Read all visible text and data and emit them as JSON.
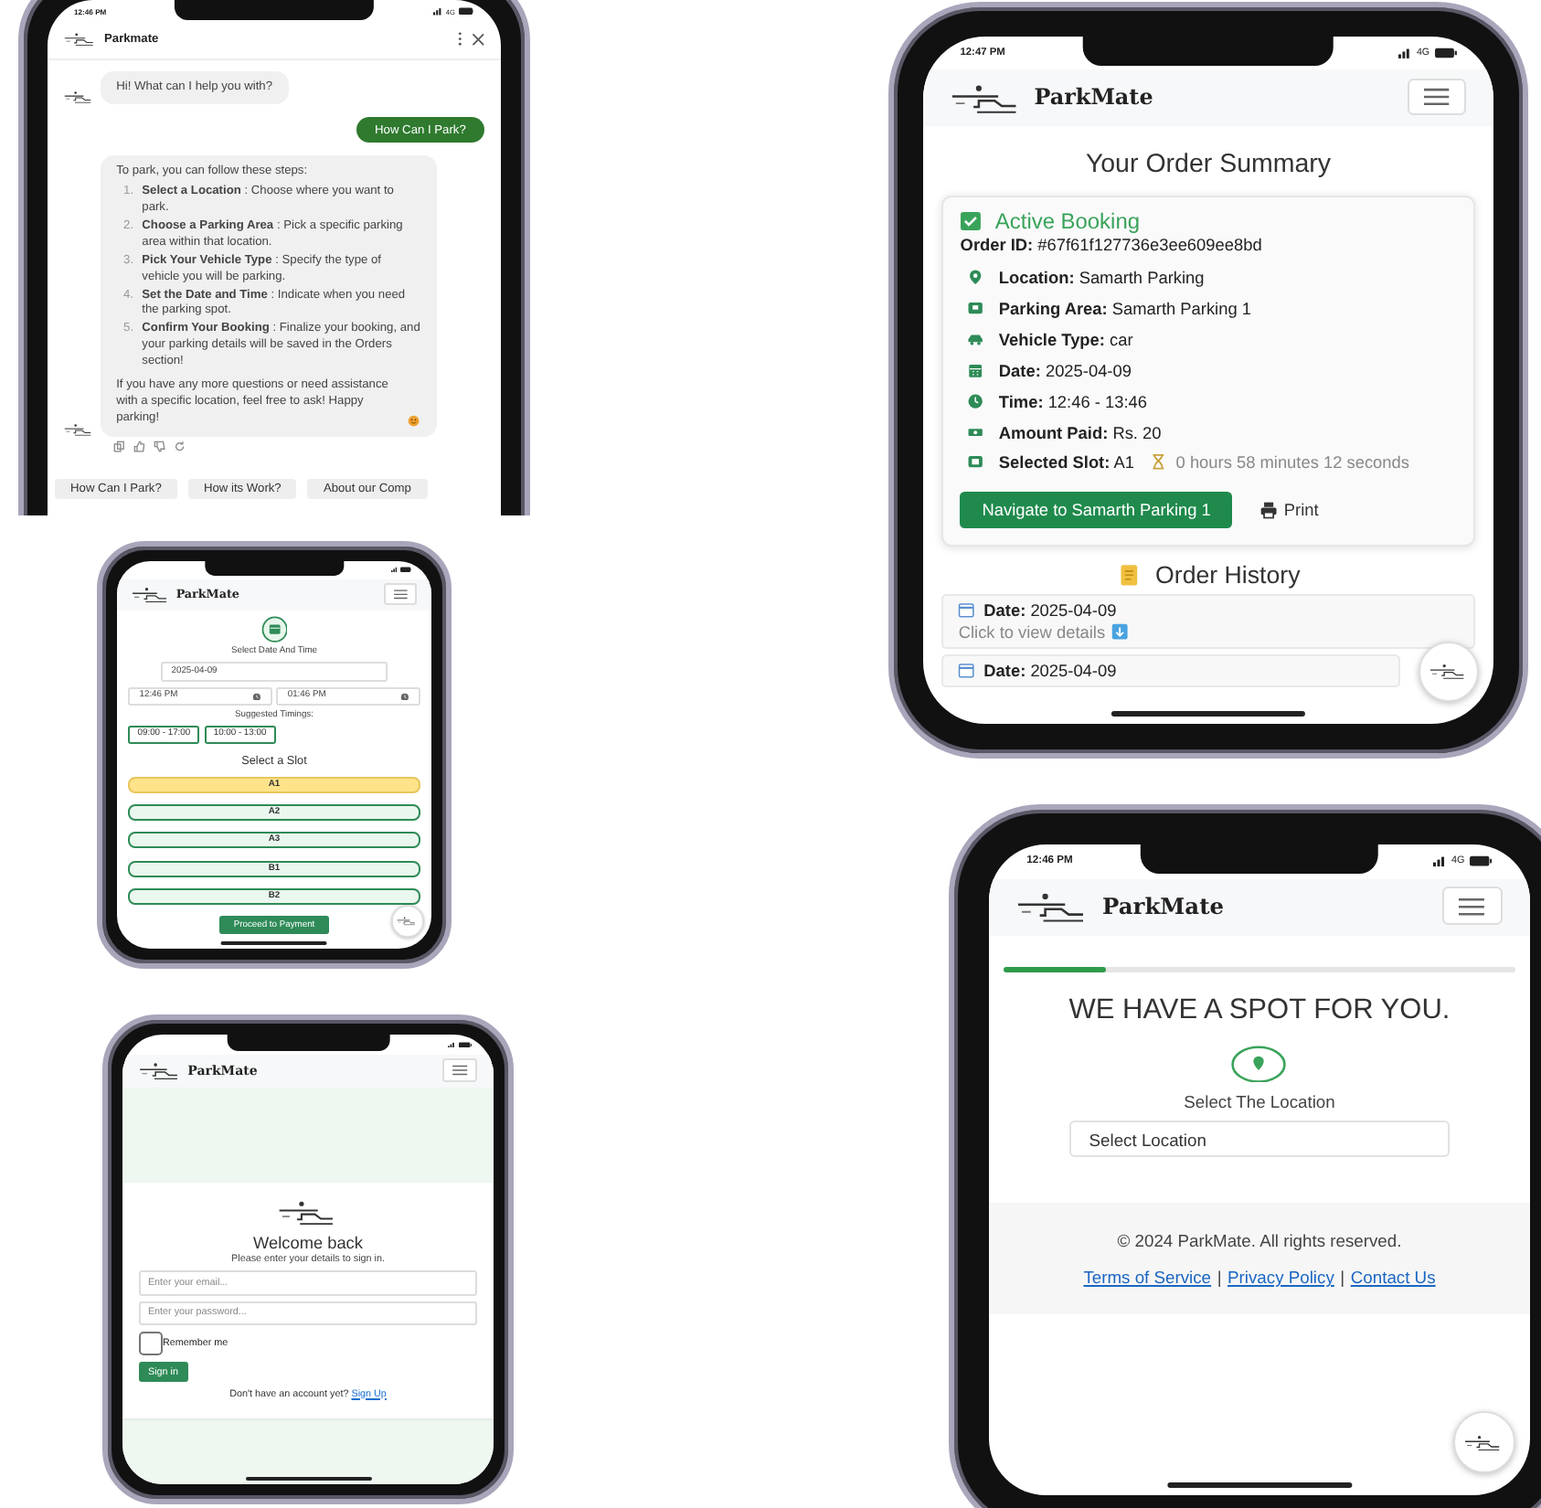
{
  "phones": [
    {
      "kind": "chat",
      "status": {
        "time": "12:46 PM",
        "network": "4G"
      },
      "header": {
        "title": "Parkmate"
      },
      "messages": [
        {
          "kind": "bot",
          "text": "Hi! What can I help you with?"
        },
        {
          "kind": "user",
          "text": "How Can I Park?"
        },
        {
          "kind": "steps",
          "intro": "To park, you can follow these steps:",
          "steps": [
            {
              "number": "1.",
              "text": "**Select a Location** : Choose where you want to park."
            },
            {
              "number": "2.",
              "text": "**Choose a Parking Area** : Pick a specific parking area within that location."
            },
            {
              "number": "3.",
              "text": "**Pick Your Vehicle Type** : Specify the type of vehicle you will be parking."
            },
            {
              "number": "4.",
              "text": "**Set the Date and Time** : Indicate when you need the parking spot."
            },
            {
              "number": "5.",
              "text": "**Confirm Your Booking** : Finalize your booking, and your parking details will be saved in the Orders section!"
            }
          ],
          "outro": "If you have any more questions or need assistance with a specific location, feel free to ask! Happy parking!"
        }
      ],
      "suggestions": [
        "How Can I Park?",
        "How its Work?",
        "About our Comp"
      ]
    },
    {
      "kind": "slots",
      "navbar": {
        "brand": "ParkMate"
      },
      "heading": "Select Date And Time",
      "date": "2025-04-09",
      "start_time": "12:46 PM",
      "end_time": "01:46 PM",
      "suggested_label": "Suggested Timings:",
      "timings": [
        "09:00 - 17:00",
        "10:00 - 13:00"
      ],
      "slot_heading": "Select a Slot",
      "slots": [
        {
          "label": "A1",
          "selected": true
        },
        {
          "label": "A2",
          "selected": false
        },
        {
          "label": "A3",
          "selected": false
        },
        {
          "label": "B1",
          "selected": false
        },
        {
          "label": "B2",
          "selected": false
        }
      ],
      "proceed": "Proceed to Payment"
    },
    {
      "kind": "login",
      "navbar": {
        "brand": "ParkMate"
      },
      "title": "Welcome back",
      "subtitle": "Please enter your details to sign in.",
      "email_placeholder": "Enter your email...",
      "password_placeholder": "Enter your password...",
      "remember": {
        "label": "Remember me",
        "checked": false
      },
      "submit": "Sign in",
      "signup_prompt": "Don't have an account yet?",
      "signup_link": "Sign Up"
    },
    {
      "kind": "order",
      "status": {
        "time": "12:47 PM",
        "network": "4G"
      },
      "navbar": {
        "brand": "ParkMate"
      },
      "title": "Your Order Summary",
      "booking": {
        "status": "Active Booking",
        "order_id": "**Order ID:** #67f61f127736e3ee609ee8bd",
        "details": [
          {
            "kind": "location",
            "text": "**Location:** Samarth Parking"
          },
          {
            "kind": "area",
            "text": "**Parking Area:** Samarth Parking 1"
          },
          {
            "kind": "vehicle",
            "text": "**Vehicle Type:** car"
          },
          {
            "kind": "date",
            "text": "**Date:** 2025-04-09"
          },
          {
            "kind": "time",
            "text": "**Time:** 12:46 - 13:46"
          },
          {
            "kind": "amount",
            "text": "**Amount Paid:** Rs. 20"
          },
          {
            "kind": "slot",
            "text": "**Selected Slot:** A1",
            "timer": "0 hours 58 minutes 12 seconds"
          }
        ],
        "navigate": "Navigate to Samarth Parking 1",
        "print": "Print"
      },
      "history_title": "Order History",
      "history": [
        {
          "date": "**Date:** 2025-04-09",
          "hint": "Click to view details"
        },
        {
          "date": "**Date:** 2025-04-09"
        }
      ]
    },
    {
      "kind": "location",
      "status": {
        "time": "12:46 PM",
        "network": "4G"
      },
      "navbar": {
        "brand": "ParkMate"
      },
      "progress": {
        "level": 0.2
      },
      "title": "WE HAVE A SPOT FOR YOU.",
      "prompt": "Select The Location",
      "select": {
        "value": "Select Location"
      },
      "footer": {
        "copyright": "© 2024 ParkMate. All rights reserved.",
        "links": [
          "Terms of Service",
          "Privacy Policy",
          "Contact Us"
        ],
        "separator": "|"
      }
    }
  ]
}
